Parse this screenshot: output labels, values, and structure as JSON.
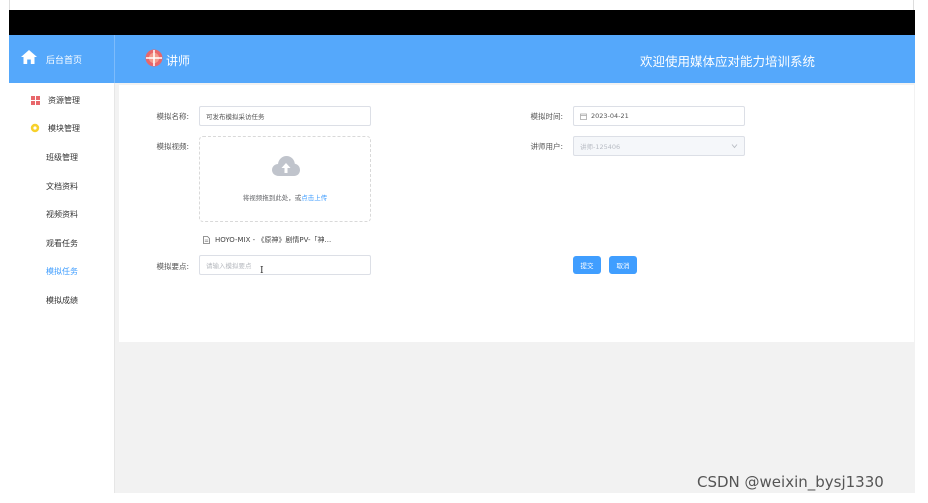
{
  "header": {
    "home_label": "后台首页",
    "brand_label": "讲师",
    "system_title": "欢迎使用媒体应对能力培训系统",
    "bg_color": "#55a8fb"
  },
  "sidebar": {
    "items": [
      {
        "label": "资源管理",
        "icon": "grid-icon"
      },
      {
        "label": "模块管理",
        "icon": "gear-icon"
      },
      {
        "label": "班级管理"
      },
      {
        "label": "文档资料"
      },
      {
        "label": "视频资料"
      },
      {
        "label": "观看任务"
      },
      {
        "label": "模拟任务",
        "active": true
      },
      {
        "label": "模拟成绩"
      }
    ],
    "active_color": "#409eff"
  },
  "form": {
    "name_label": "模拟名称:",
    "name_value": "可发布模拟采访任务",
    "time_label": "模拟时间:",
    "time_value": "2023-04-21",
    "video_label": "模拟视频:",
    "upload_text": "将视频拖到此处，或",
    "upload_link": "点击上传",
    "teacher_label": "讲师用户:",
    "teacher_value": "讲师-125406",
    "file_name": "HOYO-MIX - 《原神》剧情PV-「神...",
    "points_label": "模拟要点:",
    "points_placeholder": "请输入模拟要点",
    "submit_label": "提交",
    "cancel_label": "取消"
  },
  "watermark": "CSDN @weixin_bysj1330"
}
